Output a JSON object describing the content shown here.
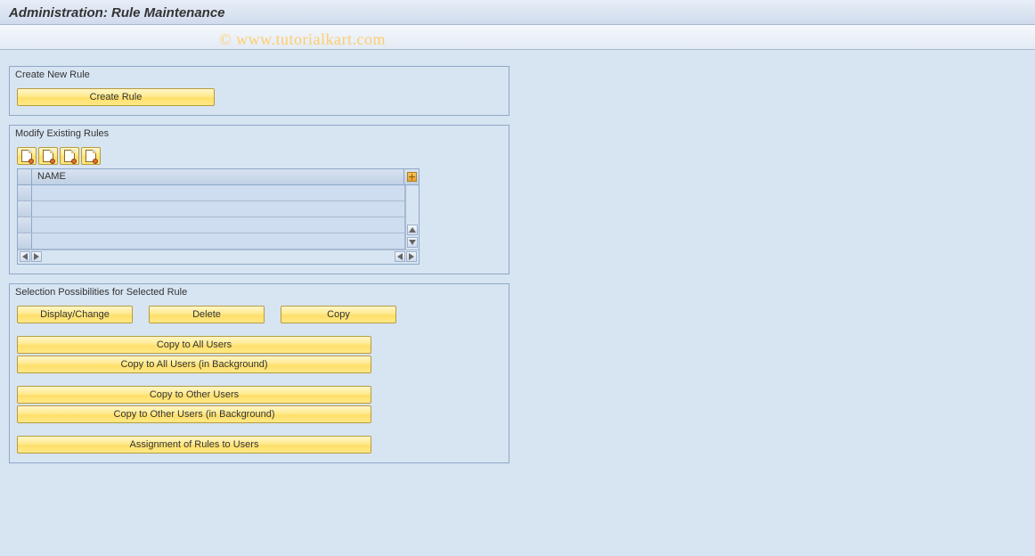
{
  "header": {
    "title": "Administration: Rule Maintenance"
  },
  "watermark": "© www.tutorialkart.com",
  "panels": {
    "create": {
      "title": "Create New Rule",
      "buttons": {
        "create_rule": "Create Rule"
      }
    },
    "modify": {
      "title": "Modify Existing Rules",
      "toolbar_icons": [
        "doc-icon-1",
        "doc-icon-2",
        "doc-icon-3",
        "doc-icon-4"
      ],
      "grid": {
        "columns": [
          "NAME"
        ],
        "rows": [
          "",
          "",
          "",
          ""
        ]
      }
    },
    "selection": {
      "title": "Selection Possibilities for Selected Rule",
      "row_buttons": {
        "display_change": "Display/Change",
        "delete": "Delete",
        "copy": "Copy"
      },
      "group1": {
        "copy_all": "Copy to All Users",
        "copy_all_bg": "Copy to All Users (in Background)"
      },
      "group2": {
        "copy_other": "Copy to Other Users",
        "copy_other_bg": "Copy to Other Users (in Background)"
      },
      "group3": {
        "assignment": "Assignment of Rules to Users"
      }
    }
  }
}
